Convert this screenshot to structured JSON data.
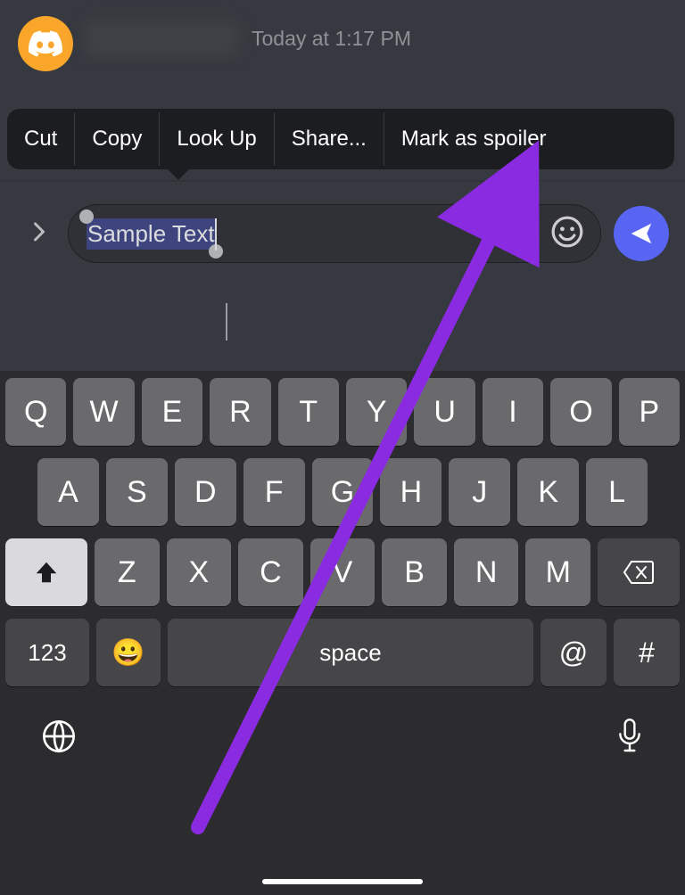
{
  "message": {
    "timestamp": "Today at 1:17 PM"
  },
  "contextMenu": {
    "items": [
      {
        "label": "Cut"
      },
      {
        "label": "Copy"
      },
      {
        "label": "Look Up"
      },
      {
        "label": "Share..."
      },
      {
        "label": "Mark as spoiler"
      }
    ]
  },
  "input": {
    "selectedText": "Sample Text"
  },
  "keyboard": {
    "row1": [
      "Q",
      "W",
      "E",
      "R",
      "T",
      "Y",
      "U",
      "I",
      "O",
      "P"
    ],
    "row2": [
      "A",
      "S",
      "D",
      "F",
      "G",
      "H",
      "J",
      "K",
      "L"
    ],
    "row3": [
      "Z",
      "X",
      "C",
      "V",
      "B",
      "N",
      "M"
    ],
    "numKey": "123",
    "emojiKey": "😀",
    "spaceKey": "space",
    "atKey": "@",
    "hashKey": "#"
  },
  "annotation": {
    "color": "#8a2be2"
  }
}
